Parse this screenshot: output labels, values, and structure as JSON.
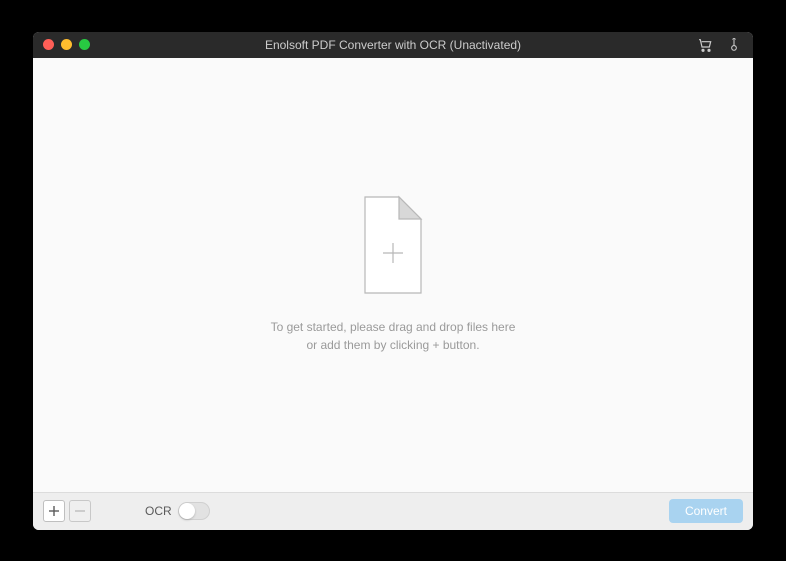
{
  "titlebar": {
    "title": "Enolsoft PDF Converter with OCR (Unactivated)"
  },
  "main": {
    "empty_line1": "To get started, please drag and drop files here",
    "empty_line2": "or add them by clicking + button."
  },
  "footer": {
    "ocr_label": "OCR",
    "convert_label": "Convert"
  }
}
